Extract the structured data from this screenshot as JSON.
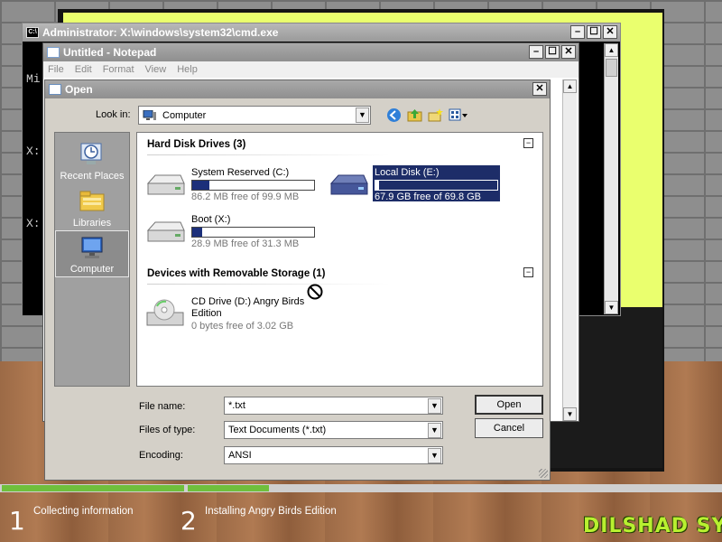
{
  "cmd_window": {
    "title": "Administrator: X:\\windows\\system32\\cmd.exe",
    "icon_label": "C:\\",
    "lines": [
      "Mi",
      "",
      "X:",
      "",
      "X:"
    ],
    "buttons": [
      "–",
      "☐",
      "✕"
    ]
  },
  "notepad": {
    "title": "Untitled - Notepad",
    "menu": [
      "File",
      "Edit",
      "Format",
      "View",
      "Help"
    ],
    "buttons": [
      "–",
      "☐",
      "✕"
    ]
  },
  "dialog": {
    "title": "Open",
    "close_label": "✕",
    "look_in_label": "Look in:",
    "look_in_value": "Computer",
    "places": [
      {
        "label": "Recent Places",
        "icon": "recent-places-icon",
        "selected": false
      },
      {
        "label": "Libraries",
        "icon": "libraries-icon",
        "selected": false
      },
      {
        "label": "Computer",
        "icon": "computer-icon",
        "selected": true
      }
    ],
    "groups": [
      {
        "header": "Hard Disk Drives (3)",
        "collapse": "−",
        "drives": [
          {
            "name": "System Reserved (C:)",
            "free": "86.2 MB free of 99.9 MB",
            "used_fraction": 0.14,
            "selected": false
          },
          {
            "name": "Local Disk (E:)",
            "free": "67.9 GB free of 69.8 GB",
            "used_fraction": 0.03,
            "selected": true
          },
          {
            "name": "Boot (X:)",
            "free": "28.9 MB free of 31.3 MB",
            "used_fraction": 0.08,
            "selected": false
          }
        ]
      },
      {
        "header": "Devices with Removable Storage (1)",
        "collapse": "−",
        "devices": [
          {
            "name_line1": "CD Drive (D:) Angry Birds",
            "name_line2": "Edition",
            "free": "0 bytes free of 3.02 GB"
          }
        ]
      }
    ],
    "file_name_label": "File name:",
    "file_name_value": "*.txt",
    "file_type_label": "Files of type:",
    "file_type_value": "Text Documents (*.txt)",
    "encoding_label": "Encoding:",
    "encoding_value": "ANSI",
    "open_button": "Open",
    "cancel_button": "Cancel"
  },
  "setup": {
    "steps": [
      {
        "number": "1",
        "label": "Collecting information"
      },
      {
        "number": "2",
        "label": "Installing Angry Birds Edition"
      }
    ],
    "brand": "DILSHAD SYS",
    "accent": "#6fbf3c"
  }
}
